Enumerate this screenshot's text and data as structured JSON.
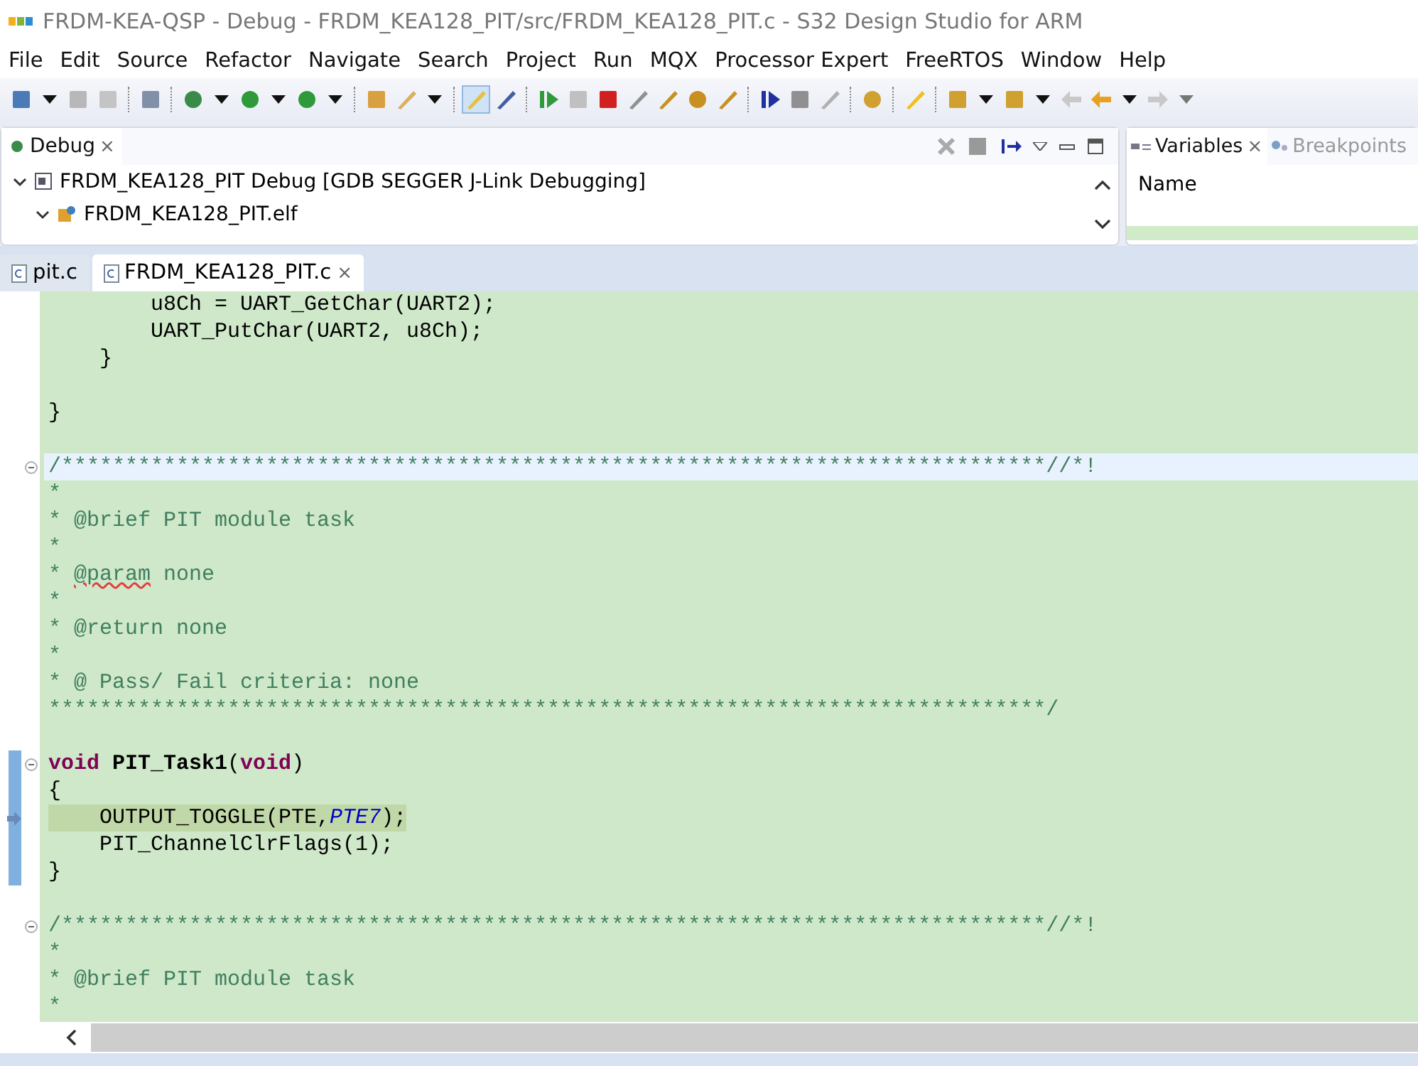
{
  "window": {
    "title": "FRDM-KEA-QSP - Debug - FRDM_KEA128_PIT/src/FRDM_KEA128_PIT.c - S32 Design Studio for ARM"
  },
  "menu": [
    "File",
    "Edit",
    "Source",
    "Refactor",
    "Navigate",
    "Search",
    "Project",
    "Run",
    "MQX",
    "Processor Expert",
    "FreeRTOS",
    "Window",
    "Help"
  ],
  "debug_view": {
    "tab": {
      "label": "Debug",
      "close": "×"
    },
    "tree": [
      {
        "label": "FRDM_KEA128_PIT Debug [GDB SEGGER J-Link Debugging]",
        "expanded": true,
        "children": [
          {
            "label": "FRDM_KEA128_PIT.elf",
            "expanded": true
          }
        ]
      }
    ]
  },
  "variables_view": {
    "tabs": [
      {
        "label": "Variables",
        "close": "×",
        "selected": true
      },
      {
        "label": "Breakpoints",
        "selected": false
      }
    ],
    "column": "Name"
  },
  "editor": {
    "tabs": [
      {
        "label": "pit.c",
        "selected": false
      },
      {
        "label": "FRDM_KEA128_PIT.c",
        "close": "×",
        "selected": true
      }
    ],
    "lines": [
      {
        "fold": false,
        "cursor": false,
        "executing": false,
        "in_range": false,
        "tokens": [
          {
            "kind": "plain",
            "text": "        u8Ch = UART_GetChar(UART2);"
          }
        ]
      },
      {
        "fold": false,
        "cursor": false,
        "executing": false,
        "in_range": false,
        "tokens": [
          {
            "kind": "plain",
            "text": "        UART_PutChar(UART2, u8Ch);"
          }
        ]
      },
      {
        "fold": false,
        "cursor": false,
        "executing": false,
        "in_range": false,
        "tokens": [
          {
            "kind": "plain",
            "text": "    }"
          }
        ]
      },
      {
        "kind": "blank"
      },
      {
        "fold": false,
        "cursor": false,
        "executing": false,
        "in_range": false,
        "tokens": [
          {
            "kind": "plain",
            "text": "}"
          }
        ]
      },
      {
        "kind": "blank"
      },
      {
        "fold": true,
        "cursor": true,
        "executing": false,
        "in_range": false,
        "tokens": [
          {
            "kind": "comment",
            "text": "/*****************************************************************************//*!"
          }
        ]
      },
      {
        "fold": false,
        "cursor": false,
        "executing": false,
        "in_range": false,
        "tokens": [
          {
            "kind": "comment",
            "text": "*"
          }
        ]
      },
      {
        "fold": false,
        "cursor": false,
        "executing": false,
        "in_range": false,
        "tokens": [
          {
            "kind": "comment",
            "text": "* @brief PIT module task"
          }
        ]
      },
      {
        "fold": false,
        "cursor": false,
        "executing": false,
        "in_range": false,
        "tokens": [
          {
            "kind": "comment",
            "text": "*"
          }
        ]
      },
      {
        "fold": false,
        "cursor": false,
        "executing": false,
        "in_range": false,
        "tokens": [
          {
            "kind": "comment",
            "text": "* "
          },
          {
            "kind": "misspelled",
            "text": "@param"
          },
          {
            "kind": "comment",
            "text": " none"
          }
        ]
      },
      {
        "fold": false,
        "cursor": false,
        "executing": false,
        "in_range": false,
        "tokens": [
          {
            "kind": "comment",
            "text": "*"
          }
        ]
      },
      {
        "fold": false,
        "cursor": false,
        "executing": false,
        "in_range": false,
        "tokens": [
          {
            "kind": "comment",
            "text": "* @return none"
          }
        ]
      },
      {
        "fold": false,
        "cursor": false,
        "executing": false,
        "in_range": false,
        "tokens": [
          {
            "kind": "comment",
            "text": "*"
          }
        ]
      },
      {
        "fold": false,
        "cursor": false,
        "executing": false,
        "in_range": false,
        "tokens": [
          {
            "kind": "comment",
            "text": "* @ Pass/ Fail criteria: none"
          }
        ]
      },
      {
        "fold": false,
        "cursor": false,
        "executing": false,
        "in_range": false,
        "tokens": [
          {
            "kind": "comment",
            "text": "******************************************************************************/"
          }
        ]
      },
      {
        "kind": "blank"
      },
      {
        "fold": true,
        "cursor": false,
        "executing": false,
        "in_range": true,
        "tokens": [
          {
            "kind": "keyword",
            "text": "void"
          },
          {
            "kind": "function",
            "text": " PIT_Task1"
          },
          {
            "kind": "plain",
            "text": "("
          },
          {
            "kind": "keyword",
            "text": "void"
          },
          {
            "kind": "plain",
            "text": ")"
          }
        ]
      },
      {
        "fold": false,
        "cursor": false,
        "executing": false,
        "in_range": true,
        "tokens": [
          {
            "kind": "plain",
            "text": "{"
          }
        ]
      },
      {
        "fold": false,
        "cursor": false,
        "executing": true,
        "in_range": true,
        "tokens": [
          {
            "kind": "plain",
            "text": "    OUTPUT_TOGGLE(PTE,"
          },
          {
            "kind": "macro",
            "text": "PTE7"
          },
          {
            "kind": "plain",
            "text": ");"
          }
        ]
      },
      {
        "fold": false,
        "cursor": false,
        "executing": false,
        "in_range": true,
        "tokens": [
          {
            "kind": "plain",
            "text": "    PIT_ChannelClrFlags(1);"
          }
        ]
      },
      {
        "fold": false,
        "cursor": false,
        "executing": false,
        "in_range": true,
        "tokens": [
          {
            "kind": "plain",
            "text": "}"
          }
        ]
      },
      {
        "kind": "blank"
      },
      {
        "fold": true,
        "cursor": false,
        "executing": false,
        "in_range": false,
        "tokens": [
          {
            "kind": "comment",
            "text": "/*****************************************************************************//*!"
          }
        ]
      },
      {
        "fold": false,
        "cursor": false,
        "executing": false,
        "in_range": false,
        "tokens": [
          {
            "kind": "comment",
            "text": "*"
          }
        ]
      },
      {
        "fold": false,
        "cursor": false,
        "executing": false,
        "in_range": false,
        "tokens": [
          {
            "kind": "comment",
            "text": "* @brief PIT module task"
          }
        ]
      },
      {
        "fold": false,
        "cursor": false,
        "executing": false,
        "in_range": false,
        "tokens": [
          {
            "kind": "comment",
            "text": "*"
          }
        ]
      }
    ]
  }
}
